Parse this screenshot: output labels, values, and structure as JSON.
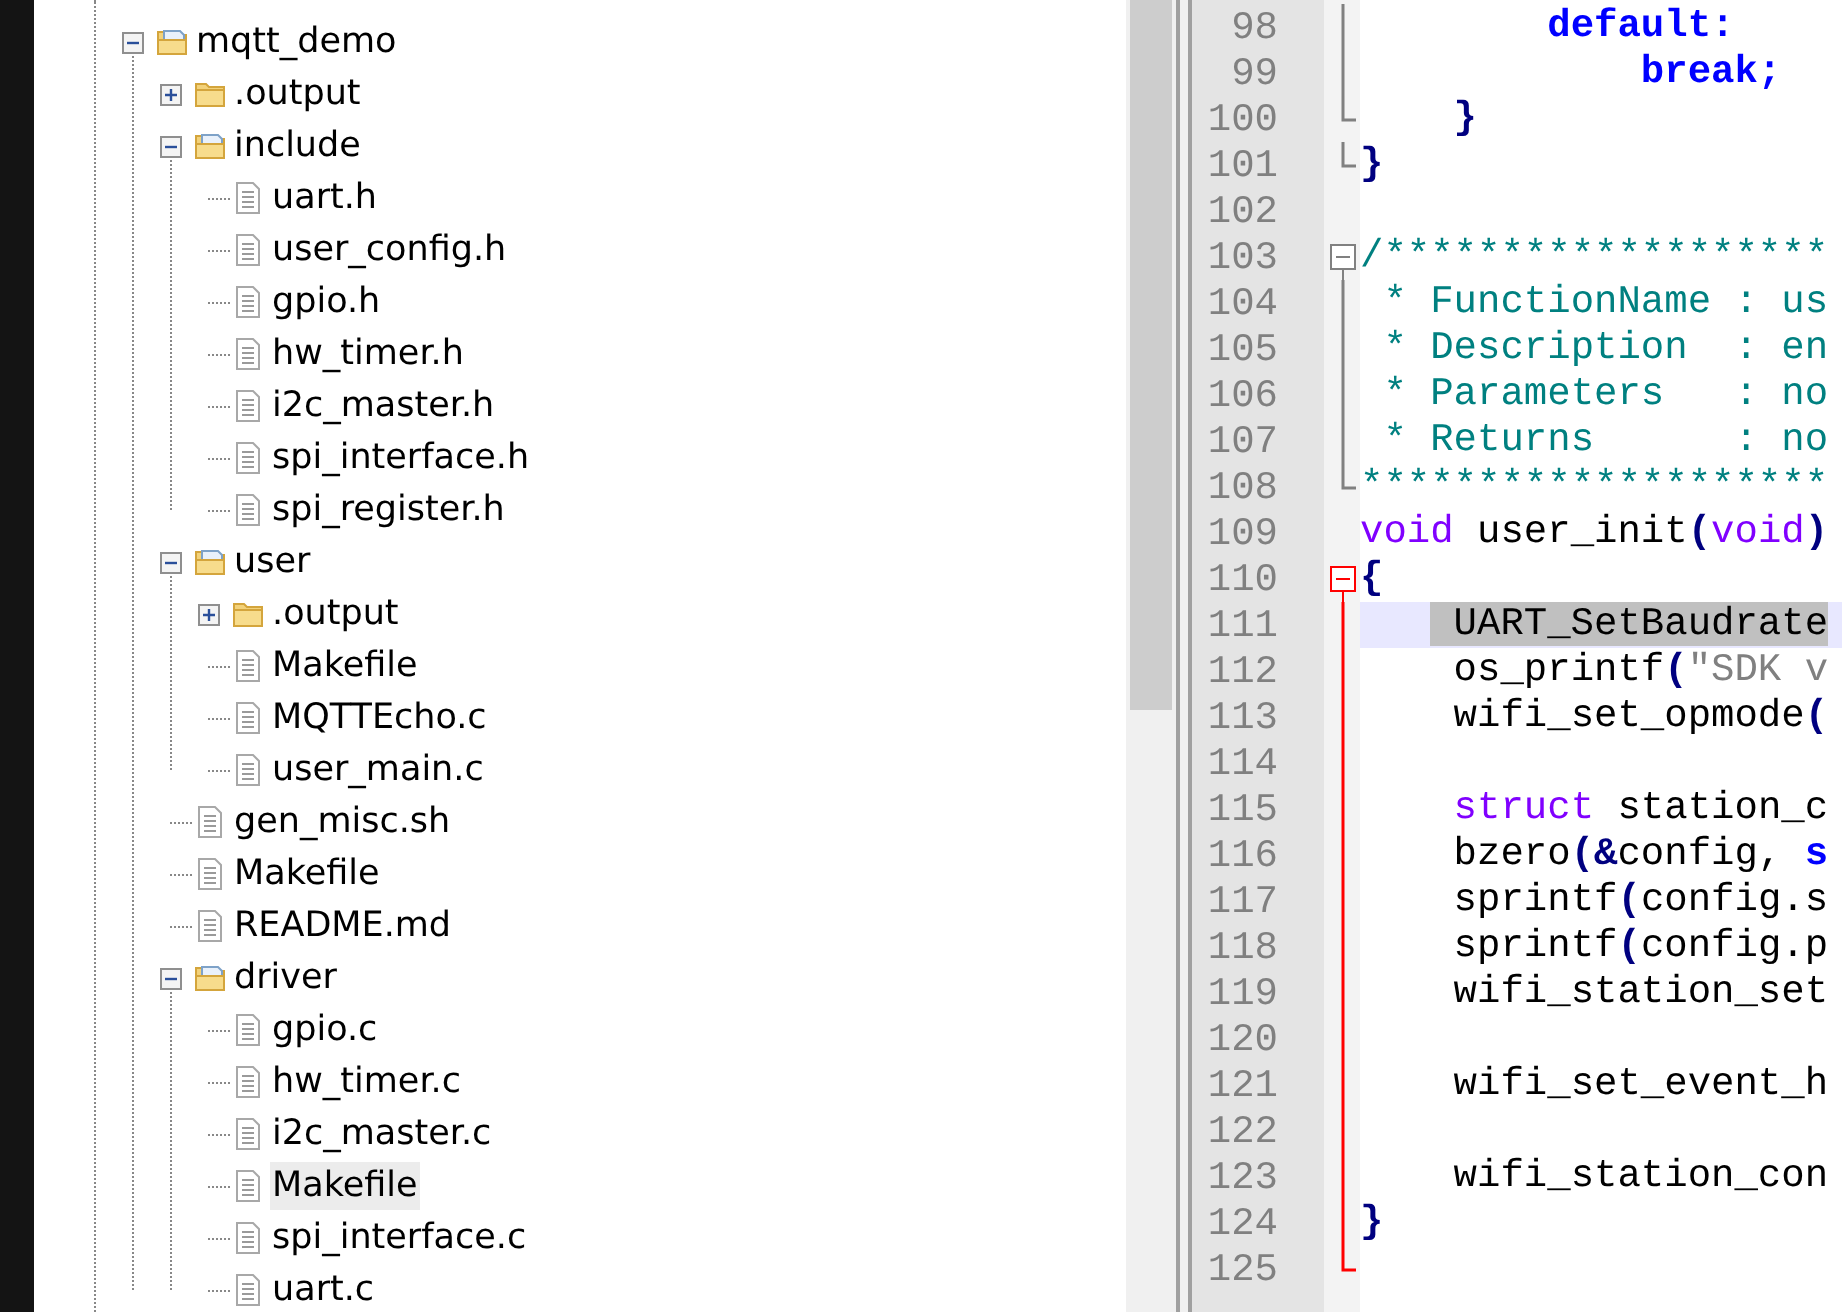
{
  "tree": [
    {
      "label": "mqtt_demo",
      "kind": "folder",
      "expanded": true,
      "selected": false,
      "children": [
        {
          "label": ".output",
          "kind": "folder",
          "expanded": false,
          "selected": false
        },
        {
          "label": "include",
          "kind": "folder",
          "expanded": true,
          "selected": false,
          "children": [
            {
              "label": "uart.h",
              "kind": "file",
              "selected": false
            },
            {
              "label": "user_config.h",
              "kind": "file",
              "selected": false
            },
            {
              "label": "gpio.h",
              "kind": "file",
              "selected": false
            },
            {
              "label": "hw_timer.h",
              "kind": "file",
              "selected": false
            },
            {
              "label": "i2c_master.h",
              "kind": "file",
              "selected": false
            },
            {
              "label": "spi_interface.h",
              "kind": "file",
              "selected": false
            },
            {
              "label": "spi_register.h",
              "kind": "file",
              "selected": false
            }
          ]
        },
        {
          "label": "user",
          "kind": "folder",
          "expanded": true,
          "selected": false,
          "children": [
            {
              "label": ".output",
              "kind": "folder",
              "expanded": false,
              "selected": false
            },
            {
              "label": "Makefile",
              "kind": "file",
              "selected": false
            },
            {
              "label": "MQTTEcho.c",
              "kind": "file",
              "selected": false
            },
            {
              "label": "user_main.c",
              "kind": "file",
              "selected": false
            }
          ]
        },
        {
          "label": "gen_misc.sh",
          "kind": "file",
          "selected": false
        },
        {
          "label": "Makefile",
          "kind": "file",
          "selected": false
        },
        {
          "label": "README.md",
          "kind": "file",
          "selected": false
        },
        {
          "label": "driver",
          "kind": "folder",
          "expanded": true,
          "selected": false,
          "children": [
            {
              "label": "gpio.c",
              "kind": "file",
              "selected": false
            },
            {
              "label": "hw_timer.c",
              "kind": "file",
              "selected": false
            },
            {
              "label": "i2c_master.c",
              "kind": "file",
              "selected": false
            },
            {
              "label": "Makefile",
              "kind": "file",
              "selected": true
            },
            {
              "label": "spi_interface.c",
              "kind": "file",
              "selected": false
            },
            {
              "label": "uart.c",
              "kind": "file",
              "selected": false
            }
          ]
        }
      ]
    }
  ],
  "editor": {
    "lines": [
      {
        "number": "98",
        "current": false,
        "fold": {
          "kind": "line",
          "active": false
        },
        "tokens": [
          {
            "kind": "keyword",
            "text": "        default:"
          }
        ]
      },
      {
        "number": "99",
        "current": false,
        "fold": {
          "kind": "line",
          "active": false
        },
        "tokens": [
          {
            "kind": "keyword",
            "text": "            break;"
          }
        ]
      },
      {
        "number": "100",
        "current": false,
        "fold": {
          "kind": "end",
          "active": false
        },
        "tokens": [
          {
            "kind": "brace",
            "text": "    }"
          }
        ]
      },
      {
        "number": "101",
        "current": false,
        "fold": {
          "kind": "end",
          "active": false
        },
        "tokens": [
          {
            "kind": "brace",
            "text": "}"
          }
        ]
      },
      {
        "number": "102",
        "current": false
      },
      {
        "number": "103",
        "current": false,
        "fold": {
          "kind": "start",
          "active": false
        },
        "tokens": [
          {
            "kind": "comment",
            "text": "/*******************"
          }
        ]
      },
      {
        "number": "104",
        "current": false,
        "fold": {
          "kind": "line",
          "active": false
        },
        "tokens": [
          {
            "kind": "comment",
            "text": " * FunctionName : us"
          }
        ]
      },
      {
        "number": "105",
        "current": false,
        "fold": {
          "kind": "line",
          "active": false
        },
        "tokens": [
          {
            "kind": "comment",
            "text": " * Description  : en"
          }
        ]
      },
      {
        "number": "106",
        "current": false,
        "fold": {
          "kind": "line",
          "active": false
        },
        "tokens": [
          {
            "kind": "comment",
            "text": " * Parameters   : no"
          }
        ]
      },
      {
        "number": "107",
        "current": false,
        "fold": {
          "kind": "line",
          "active": false
        },
        "tokens": [
          {
            "kind": "comment",
            "text": " * Returns      : no"
          }
        ]
      },
      {
        "number": "108",
        "current": false,
        "fold": {
          "kind": "end",
          "active": false
        },
        "tokens": [
          {
            "kind": "comment",
            "text": "********************"
          }
        ]
      },
      {
        "number": "109",
        "current": false,
        "tokens": [
          {
            "kind": "type",
            "text": "void"
          },
          {
            "kind": "plain",
            "text": " user_init"
          },
          {
            "kind": "brace",
            "text": "("
          },
          {
            "kind": "type",
            "text": "void"
          },
          {
            "kind": "brace",
            "text": ")"
          }
        ]
      },
      {
        "number": "110",
        "current": false,
        "fold": {
          "kind": "start",
          "active": true
        },
        "tokens": [
          {
            "kind": "brace",
            "text": "{"
          }
        ]
      },
      {
        "number": "111",
        "current": true,
        "fold": {
          "kind": "line",
          "active": true
        },
        "tokens": [
          {
            "kind": "selected",
            "text": " UART_SetBaudrate"
          }
        ]
      },
      {
        "number": "112",
        "current": false,
        "fold": {
          "kind": "line",
          "active": true
        },
        "tokens": [
          {
            "kind": "plain",
            "text": "    os_printf"
          },
          {
            "kind": "brace",
            "text": "("
          },
          {
            "kind": "string",
            "text": "\"SDK v"
          }
        ]
      },
      {
        "number": "113",
        "current": false,
        "fold": {
          "kind": "line",
          "active": true
        },
        "tokens": [
          {
            "kind": "plain",
            "text": "    wifi_set_opmode"
          },
          {
            "kind": "brace",
            "text": "("
          }
        ]
      },
      {
        "number": "114",
        "current": false,
        "fold": {
          "kind": "line",
          "active": true
        }
      },
      {
        "number": "115",
        "current": false,
        "fold": {
          "kind": "line",
          "active": true
        },
        "tokens": [
          {
            "kind": "type",
            "text": "    struct"
          },
          {
            "kind": "plain",
            "text": " station_c"
          }
        ]
      },
      {
        "number": "116",
        "current": false,
        "fold": {
          "kind": "line",
          "active": true
        },
        "tokens": [
          {
            "kind": "plain",
            "text": "    bzero"
          },
          {
            "kind": "brace",
            "text": "(&"
          },
          {
            "kind": "plain",
            "text": "config, "
          },
          {
            "kind": "keyword",
            "text": "s"
          }
        ]
      },
      {
        "number": "117",
        "current": false,
        "fold": {
          "kind": "line",
          "active": true
        },
        "tokens": [
          {
            "kind": "plain",
            "text": "    sprintf"
          },
          {
            "kind": "brace",
            "text": "("
          },
          {
            "kind": "plain",
            "text": "config.s"
          }
        ]
      },
      {
        "number": "118",
        "current": false,
        "fold": {
          "kind": "line",
          "active": true
        },
        "tokens": [
          {
            "kind": "plain",
            "text": "    sprintf"
          },
          {
            "kind": "brace",
            "text": "("
          },
          {
            "kind": "plain",
            "text": "config.p"
          }
        ]
      },
      {
        "number": "119",
        "current": false,
        "fold": {
          "kind": "line",
          "active": true
        },
        "tokens": [
          {
            "kind": "plain",
            "text": "    wifi_station_set"
          }
        ]
      },
      {
        "number": "120",
        "current": false,
        "fold": {
          "kind": "line",
          "active": true
        }
      },
      {
        "number": "121",
        "current": false,
        "fold": {
          "kind": "line",
          "active": true
        },
        "tokens": [
          {
            "kind": "plain",
            "text": "    wifi_set_event_h"
          }
        ]
      },
      {
        "number": "122",
        "current": false,
        "fold": {
          "kind": "line",
          "active": true
        }
      },
      {
        "number": "123",
        "current": false,
        "fold": {
          "kind": "line",
          "active": true
        },
        "tokens": [
          {
            "kind": "plain",
            "text": "    wifi_station_con"
          }
        ]
      },
      {
        "number": "124",
        "current": false,
        "fold": {
          "kind": "line",
          "active": true
        },
        "tokens": [
          {
            "kind": "brace",
            "text": "}"
          }
        ]
      },
      {
        "number": "125",
        "current": false,
        "fold": {
          "kind": "end",
          "active": true
        }
      }
    ]
  }
}
